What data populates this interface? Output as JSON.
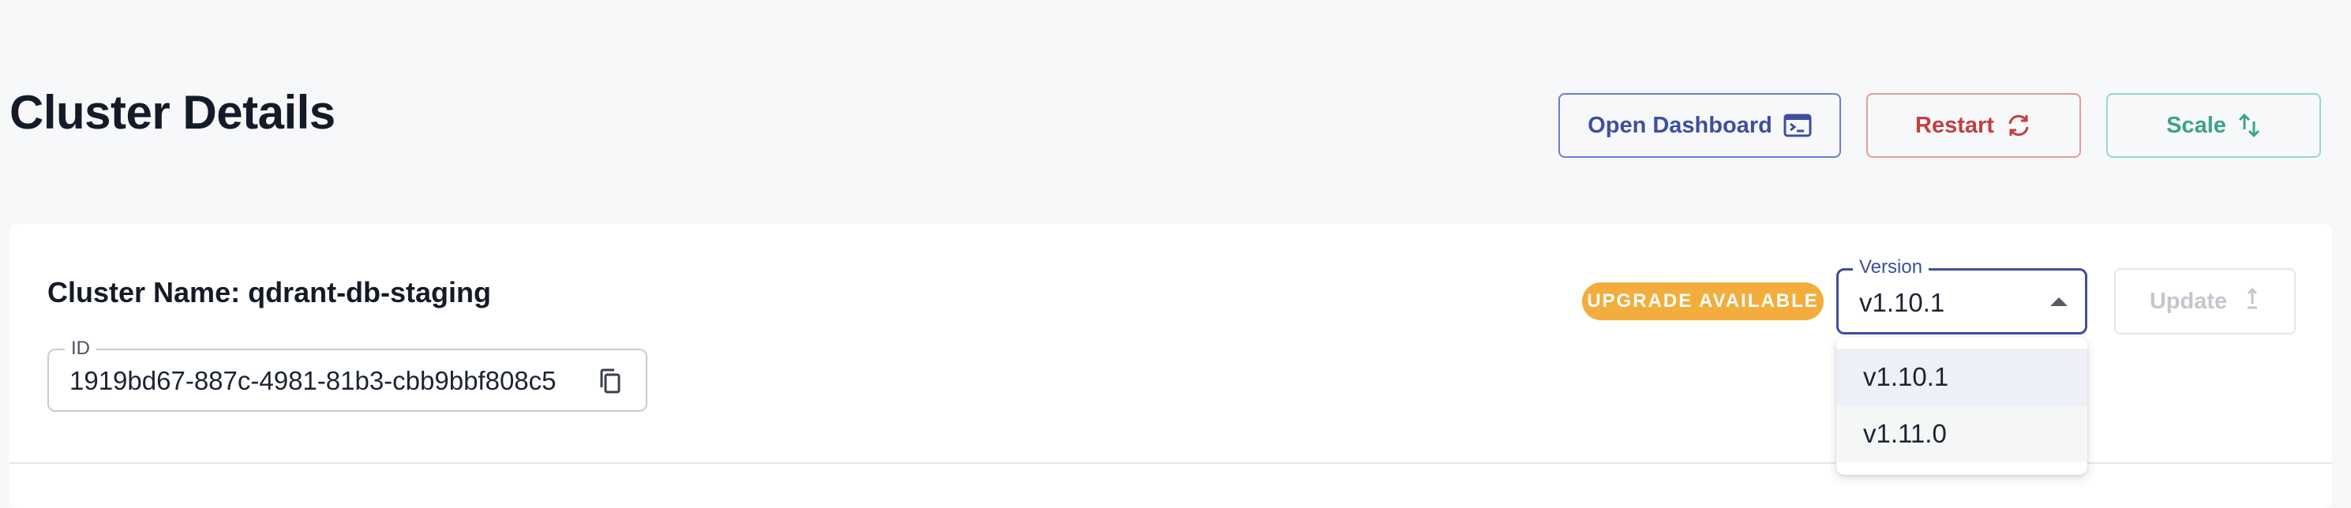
{
  "header": {
    "title": "Cluster Details",
    "actions": {
      "dashboard_label": "Open Dashboard",
      "restart_label": "Restart",
      "scale_label": "Scale"
    }
  },
  "cluster": {
    "name_line": "Cluster Name: qdrant-db-staging",
    "id_label": "ID",
    "id_value": "1919bd67-887c-4981-81b3-cbb9bbf808c5"
  },
  "upgrade": {
    "badge": "UPGRADE AVAILABLE",
    "version_label": "Version",
    "selected_version": "v1.10.1",
    "options": [
      "v1.10.1",
      "v1.11.0"
    ],
    "update_label": "Update"
  },
  "icons": {
    "dashboard": "terminal-icon",
    "restart": "refresh-icon",
    "scale": "swap-vertical-icon",
    "copy": "copy-icon",
    "update": "upload-arrow-icon",
    "select": "caret-up-icon"
  },
  "colors": {
    "primary": "#3d4f9f",
    "danger": "#c0413f",
    "success": "#3ba38b",
    "warning_badge": "#f2ad3c"
  }
}
